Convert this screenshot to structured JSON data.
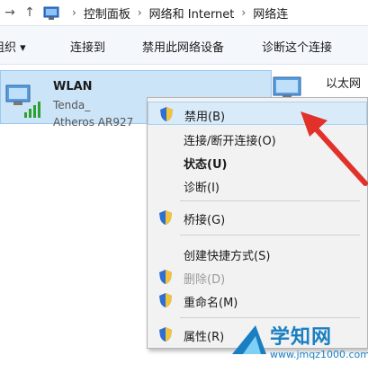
{
  "address_bar": {
    "crumbs": [
      "控制面板",
      "网络和 Internet",
      "网络连"
    ]
  },
  "command_bar": {
    "organize_label": "组织 ▾",
    "connect_to_label": "连接到",
    "disable_device_label": "禁用此网络设备",
    "diagnose_label": "诊断这个连接"
  },
  "adapters": {
    "wlan": {
      "name": "WLAN",
      "ssid": "Tenda_",
      "hardware": "Atheros AR927"
    },
    "ethernet": {
      "name": "以太网"
    }
  },
  "context_menu": {
    "items": [
      {
        "label": "禁用(B)"
      },
      {
        "label": "连接/断开连接(O)"
      },
      {
        "label": "状态(U)"
      },
      {
        "label": "诊断(I)"
      },
      {
        "label": "桥接(G)"
      },
      {
        "label": "创建快捷方式(S)"
      },
      {
        "label": "删除(D)"
      },
      {
        "label": "重命名(M)"
      },
      {
        "label": "属性(R)"
      }
    ]
  },
  "watermark": {
    "title": "学知网",
    "url": "www.jmqz1000.com"
  },
  "colors": {
    "selection": "#cce4f7",
    "menu_highlight": "#d9ebf9",
    "arrow": "#e2312a",
    "watermark": "#1a7fc2"
  }
}
